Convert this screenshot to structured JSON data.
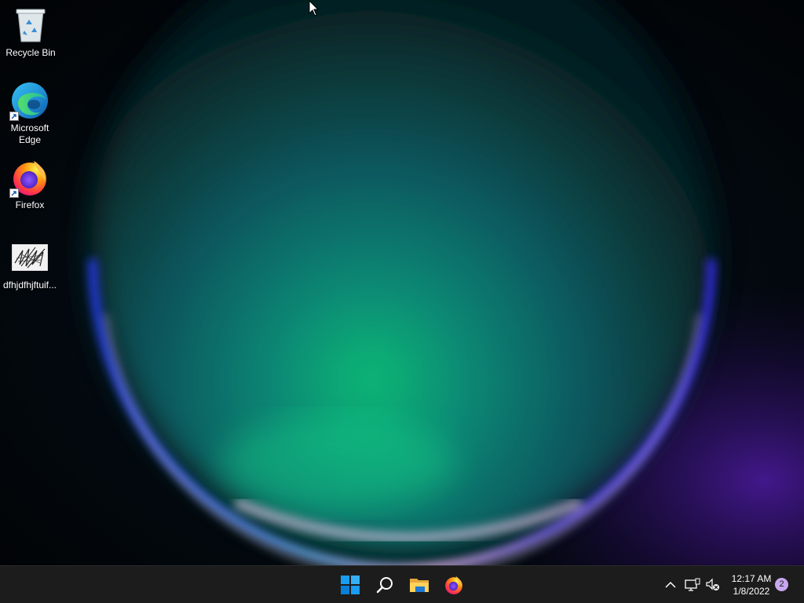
{
  "desktop": {
    "icons": [
      {
        "label": "Recycle Bin"
      },
      {
        "label": "Microsoft Edge"
      },
      {
        "label": "Firefox"
      },
      {
        "label": "dfhjdfhjftuif..."
      }
    ]
  },
  "taskbar": {
    "pinned": [
      {
        "name": "Start",
        "icon": "windows-logo-icon"
      },
      {
        "name": "Search",
        "icon": "search-icon"
      },
      {
        "name": "File Explorer",
        "icon": "folder-icon"
      },
      {
        "name": "Firefox",
        "icon": "firefox-icon"
      }
    ],
    "tray": {
      "icons": [
        "chevron-up-icon",
        "network-icon",
        "volume-muted-icon"
      ],
      "time": "12:17 AM",
      "date": "1/8/2022",
      "notification_count": "2"
    }
  },
  "colors": {
    "taskbar_bg": "#1c1c1c",
    "start_blue": "#0078d4",
    "badge": "#c8a6f0"
  }
}
